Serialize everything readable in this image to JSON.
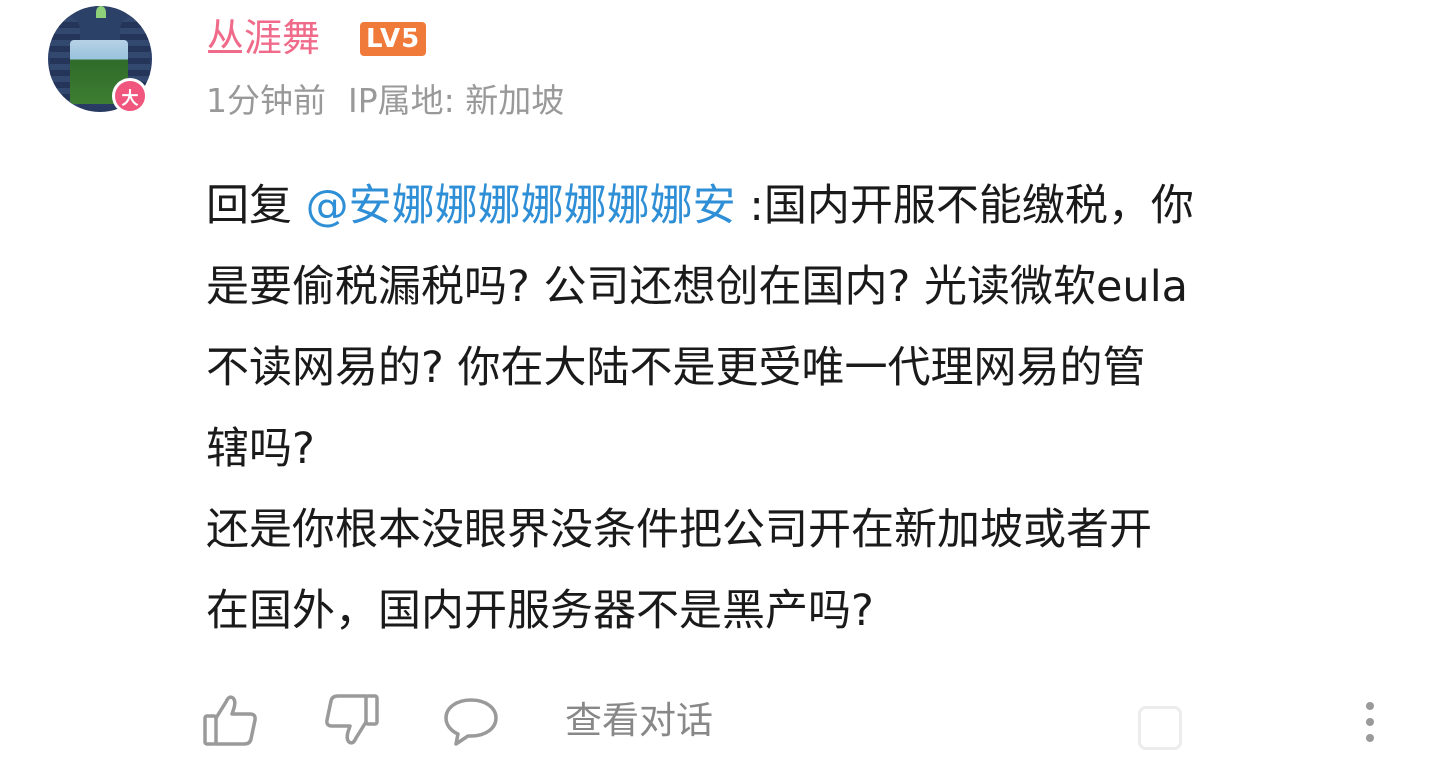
{
  "user": {
    "name": "丛涯舞",
    "level": "LV5",
    "avatar_badge": "大"
  },
  "meta": {
    "time": "1分钟前",
    "ip_location": "IP属地: 新加坡"
  },
  "comment": {
    "reply_prefix": "回复 ",
    "mention": "@安娜娜娜娜娜娜娜安",
    "line1_rest": " :国内开服不能缴税，你",
    "line2": "是要偷税漏税吗? 公司还想创在国内? 光读微软eula",
    "line3": "不读网易的? 你在大陆不是更受唯一代理网易的管",
    "line4": "辖吗?",
    "line5": "还是你根本没眼界没条件把公司开在新加坡或者开",
    "line6": "在国外，国内开服务器不是黑产吗?"
  },
  "actions": {
    "view_conversation": "查看对话"
  },
  "colors": {
    "username": "#f06a8a",
    "level_badge": "#ef7a3a",
    "mention": "#2f8fd6",
    "meta_text": "#999999",
    "icon_gray": "#9a9a9a"
  }
}
